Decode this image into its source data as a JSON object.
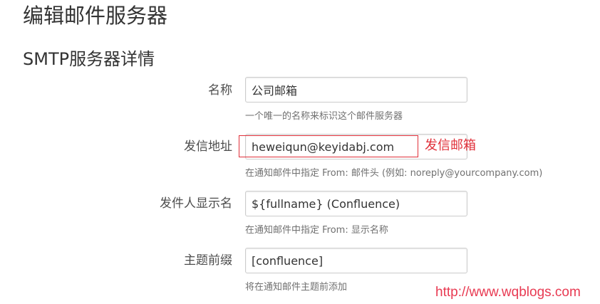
{
  "page": {
    "title": "编辑邮件服务器"
  },
  "section": {
    "title": "SMTP服务器详情"
  },
  "fields": {
    "name": {
      "label": "名称",
      "value": "公司邮箱",
      "description": "一个唯一的名称来标识这个邮件服务器"
    },
    "from_address": {
      "label": "发信地址",
      "value": "heweiqun@keyidabj.com",
      "description": "在通知邮件中指定 From: 邮件头 (例如: noreply@yourcompany.com)"
    },
    "from_name": {
      "label": "发件人显示名",
      "value": "${fullname} (Confluence)",
      "description": "在通知邮件中指定 From: 显示名称"
    },
    "subject_prefix": {
      "label": "主题前缀",
      "value": "[confluence]",
      "description": "将在通知邮件主题前添加"
    }
  },
  "annotation": {
    "text": "发信邮箱",
    "color": "#e0303a"
  },
  "watermark": {
    "text": "http://www.wqblogs.com",
    "color": "#e83a52"
  }
}
